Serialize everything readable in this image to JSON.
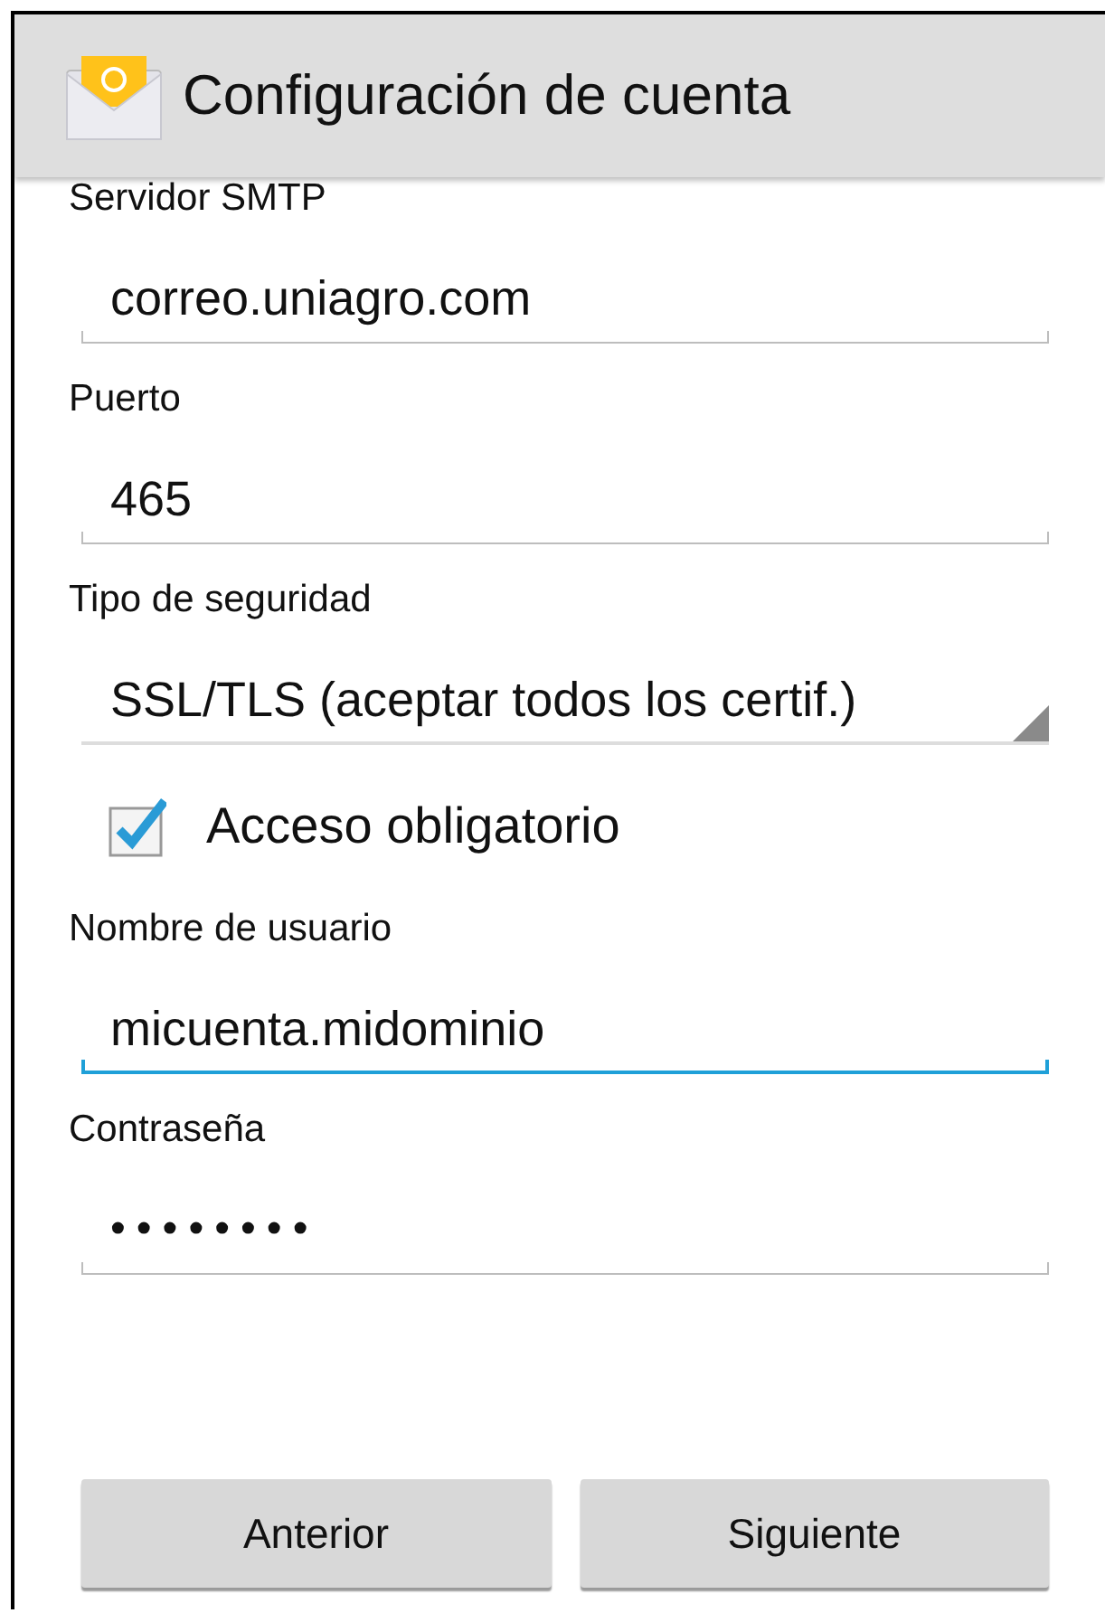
{
  "action_bar": {
    "title": "Configuración de cuenta"
  },
  "fields": [
    {
      "kind": "text",
      "label": "Servidor SMTP",
      "value": "correo.uniagro.com",
      "focused": false
    },
    {
      "kind": "text",
      "label": "Puerto",
      "value": "465",
      "focused": false
    },
    {
      "kind": "spinner",
      "label": "Tipo de seguridad",
      "value": "SSL/TLS (aceptar todos los certif.)"
    },
    {
      "kind": "checkbox",
      "label": "Acceso obligatorio",
      "checked": true
    },
    {
      "kind": "text",
      "label": "Nombre de usuario",
      "value": "micuenta.midominio",
      "focused": true
    },
    {
      "kind": "password",
      "label": "Contraseña",
      "value": "••••••••",
      "focused": false
    }
  ],
  "buttons": [
    "Anterior",
    "Siguiente"
  ]
}
